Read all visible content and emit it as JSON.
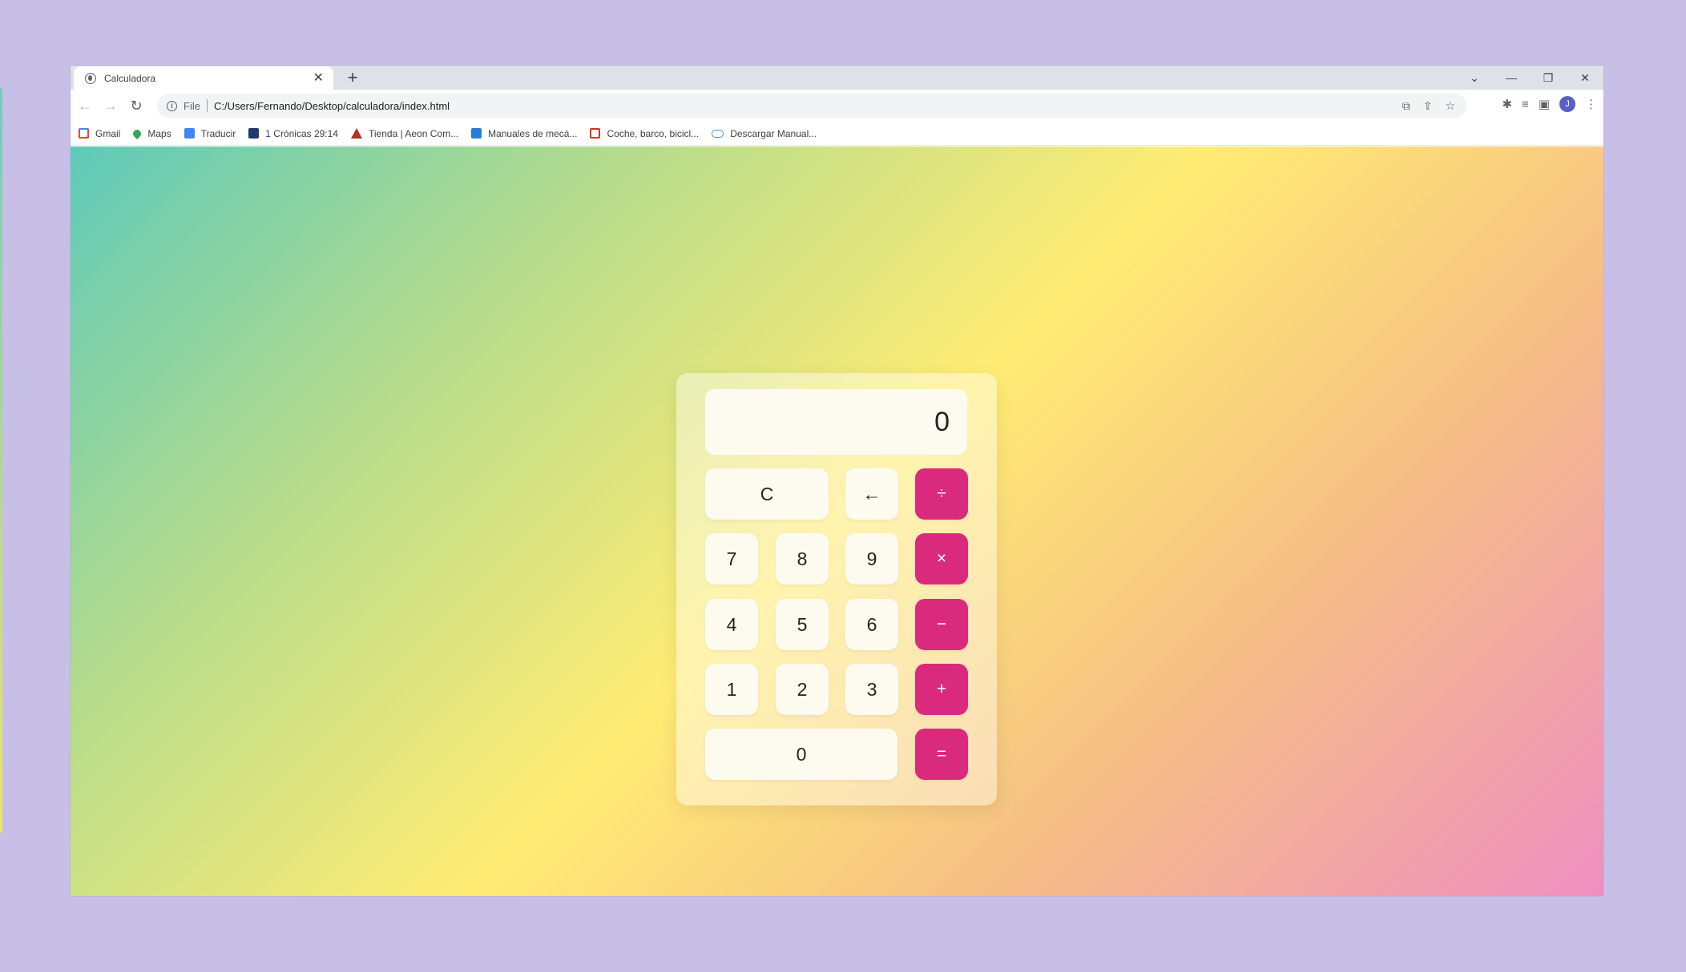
{
  "browser": {
    "tab_title": "Calculadora",
    "tab_close": "✕",
    "new_tab": "+",
    "window_controls": [
      "⌄",
      "—",
      "❐",
      "✕"
    ],
    "scheme": "File",
    "url": "C:/Users/Fernando/Desktop/calculadora/index.html",
    "avatar_letter": "J",
    "bookmarks": [
      {
        "label": "Gmail",
        "icon": "gmail-icon"
      },
      {
        "label": "Maps",
        "icon": "maps-icon"
      },
      {
        "label": "Traducir",
        "icon": "translate-icon"
      },
      {
        "label": "1 Crónicas 29:14",
        "icon": "cross-icon"
      },
      {
        "label": "Tienda | Aeon Com...",
        "icon": "aeon-icon"
      },
      {
        "label": "Manuales de mecá...",
        "icon": "manual-icon"
      },
      {
        "label": "Coche, barco, bicicl...",
        "icon": "pdf-icon"
      },
      {
        "label": "Descargar Manual...",
        "icon": "cloud-icon"
      }
    ]
  },
  "calculator": {
    "display": "0",
    "keys": {
      "clear": "C",
      "backspace": "←",
      "divide": "÷",
      "seven": "7",
      "eight": "8",
      "nine": "9",
      "multiply": "×",
      "four": "4",
      "five": "5",
      "six": "6",
      "subtract": "−",
      "one": "1",
      "two": "2",
      "three": "3",
      "add": "+",
      "zero": "0",
      "equals": "="
    },
    "accent_color": "#da2a7d"
  }
}
